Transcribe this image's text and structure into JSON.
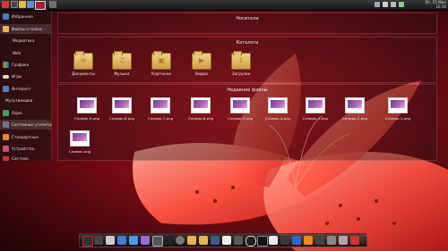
{
  "topbar": {
    "clock_date": "Вт, 15 Июн",
    "clock_time": "16:16"
  },
  "sidebar": {
    "items": [
      {
        "label": "Избранное"
      },
      {
        "label": "Файлы и папки"
      },
      {
        "label": "Медиатека"
      },
      {
        "label": "Web"
      },
      {
        "label": "Графика"
      },
      {
        "label": "Игры"
      },
      {
        "label": "Интернет"
      },
      {
        "label": "Мультимедиа"
      },
      {
        "label": "Офис"
      },
      {
        "label": "Системные утилиты"
      },
      {
        "label": "Стандартные"
      },
      {
        "label": "Устройства"
      },
      {
        "label": "Система"
      }
    ]
  },
  "panels": {
    "media": {
      "title": "Носители"
    },
    "catalogs": {
      "title": "Каталоги",
      "folders": [
        {
          "label": "Документы",
          "glyph": "≡"
        },
        {
          "label": "Музыка",
          "glyph": "♫"
        },
        {
          "label": "Картинки",
          "glyph": "▣"
        },
        {
          "label": "Видео",
          "glyph": "▶"
        },
        {
          "label": "Загрузки",
          "glyph": "⇩"
        }
      ]
    },
    "recent": {
      "title": "Недавние файлы",
      "files": [
        {
          "label": "Снимок-9.png"
        },
        {
          "label": "Снимок-8.png"
        },
        {
          "label": "Снимок-7.png"
        },
        {
          "label": "Снимок-6.png"
        },
        {
          "label": "Снимок-5.png"
        },
        {
          "label": "Снимок-4.png"
        },
        {
          "label": "Снимок-3.png"
        },
        {
          "label": "Снимок-2.png"
        },
        {
          "label": "Снимок-1.png"
        },
        {
          "label": "Снимок.png"
        }
      ]
    }
  },
  "colors": {
    "wallpaper_dark": "#1a0508",
    "wallpaper_red": "#b0101a",
    "lily": "#ff5a4a"
  }
}
